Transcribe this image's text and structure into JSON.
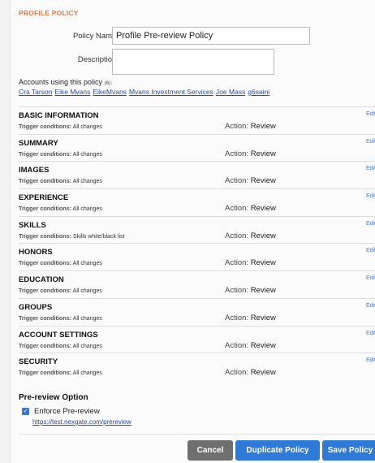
{
  "section_title": "PROFILE POLICY",
  "policy_name": {
    "label": "Policy Name:",
    "value": "Profile Pre-review Policy"
  },
  "description": {
    "label": "Description:",
    "value": ""
  },
  "accounts": {
    "label": "Accounts using this policy",
    "count": "(6):",
    "links": [
      "Cra Tarson",
      "Eike Mvans",
      "EikeMvans",
      "Mvans Investment Services",
      "Joe Mass",
      "g6saini"
    ]
  },
  "policies": [
    {
      "name": "BASIC INFORMATION",
      "trigger_label": "Trigger conditions:",
      "trigger_value": "All changes",
      "action_label": "Action:",
      "action_value": "Review",
      "edit": "Edit"
    },
    {
      "name": "SUMMARY",
      "trigger_label": "Trigger conditions:",
      "trigger_value": "All changes",
      "action_label": "Action:",
      "action_value": "Review",
      "edit": "Edit"
    },
    {
      "name": "IMAGES",
      "trigger_label": "Trigger conditions:",
      "trigger_value": "All changes",
      "action_label": "Action:",
      "action_value": "Review",
      "edit": "Edit"
    },
    {
      "name": "EXPERIENCE",
      "trigger_label": "Trigger conditions:",
      "trigger_value": "All changes",
      "action_label": "Action:",
      "action_value": "Review",
      "edit": "Edit"
    },
    {
      "name": "SKILLS",
      "trigger_label": "Trigger conditions:",
      "trigger_value": "Skills white/black list",
      "action_label": "Action:",
      "action_value": "Review",
      "edit": "Edit"
    },
    {
      "name": "HONORS",
      "trigger_label": "Trigger conditions:",
      "trigger_value": "All changes",
      "action_label": "Action:",
      "action_value": "Review",
      "edit": "Edit"
    },
    {
      "name": "EDUCATION",
      "trigger_label": "Trigger conditions:",
      "trigger_value": "All changes",
      "action_label": "Action:",
      "action_value": "Review",
      "edit": "Edit"
    },
    {
      "name": "GROUPS",
      "trigger_label": "Trigger conditions:",
      "trigger_value": "All changes",
      "action_label": "Action:",
      "action_value": "Review",
      "edit": "Edit"
    },
    {
      "name": "ACCOUNT SETTINGS",
      "trigger_label": "Trigger conditions:",
      "trigger_value": "All changes",
      "action_label": "Action:",
      "action_value": "Review",
      "edit": "Edit"
    },
    {
      "name": "SECURITY",
      "trigger_label": "Trigger conditions:",
      "trigger_value": "All changes",
      "action_label": "Action:",
      "action_value": "Review",
      "edit": "Edit"
    }
  ],
  "pre_review": {
    "title": "Pre-review Option",
    "enforce_label": "Enforce Pre-review",
    "enforce_checked": true,
    "link": "https://test.nexgate.com/prereview"
  },
  "buttons": {
    "cancel": "Cancel",
    "duplicate": "Duplicate Policy",
    "save": "Save Policy"
  },
  "colors": {
    "section_title": "#e07a4a",
    "link": "#2a4f9c",
    "primary_button": "#2f7ad6",
    "cancel_button": "#6f6f6f"
  }
}
